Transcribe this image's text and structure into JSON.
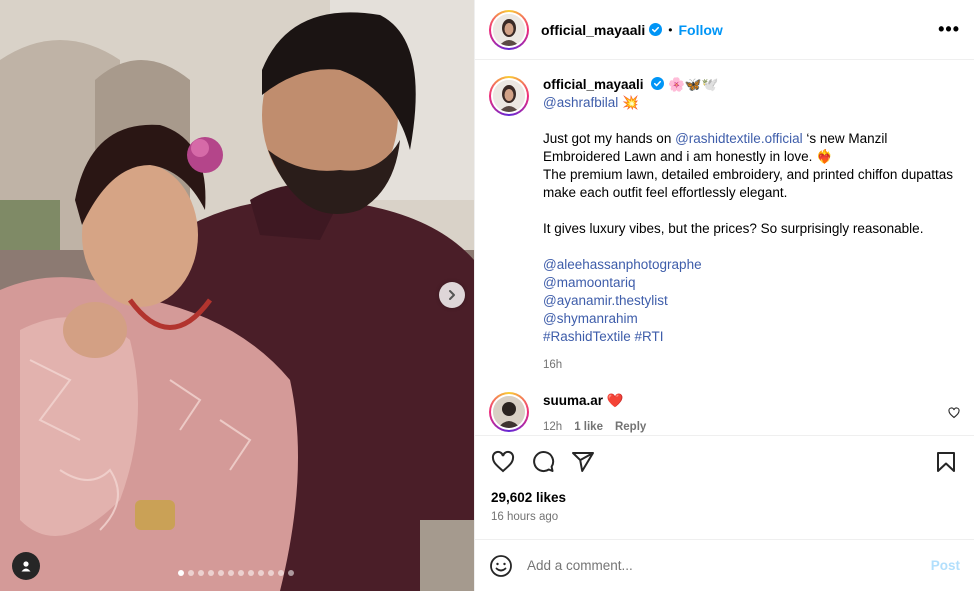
{
  "post": {
    "author": "official_mayaali",
    "follow_label": "Follow",
    "separator": "•",
    "more_label": "•••"
  },
  "caption": {
    "author": "official_mayaali",
    "emojis": "🌸🦋🕊️",
    "mention_line": "@ashrafbilal",
    "mention_emoji": "💥",
    "intro_pre": "Just got my hands on ",
    "brand_mention": "@rashidtextile.official",
    "intro_post": " ‘s new Manzil Embroidered Lawn and i am honestly in love. ❤️‍🔥",
    "line2": "The premium lawn, detailed embroidery, and printed chiffon dupattas make each outfit feel effortlessly elegant.",
    "line3": "It gives luxury vibes, but the prices? So surprisingly reasonable.",
    "credits": [
      "@aleehassanphotographe",
      "@mamoontariq",
      "@ayanamir.thestylist",
      "@shymanrahim"
    ],
    "hashtags": "#RashidTextile #RTI",
    "time": "16h"
  },
  "comment": {
    "user": "suuma.ar",
    "emoji": "❤️",
    "time": "12h",
    "likes": "1 like",
    "reply": "Reply"
  },
  "stats": {
    "likes": "29,602 likes",
    "posted": "16 hours ago"
  },
  "composer": {
    "placeholder": "Add a comment...",
    "post_label": "Post"
  },
  "carousel": {
    "slide_count": 12,
    "active_index": 0
  },
  "colors": {
    "link": "#3e5daa",
    "follow": "#0095f6",
    "post_disabled": "#b2dffc",
    "verified": "#0095f6"
  },
  "icons": [
    "verified-icon",
    "more-icon",
    "heart-icon",
    "comment-icon",
    "share-icon",
    "bookmark-icon",
    "emoji-icon",
    "chevron-right-icon",
    "user-tag-icon"
  ]
}
